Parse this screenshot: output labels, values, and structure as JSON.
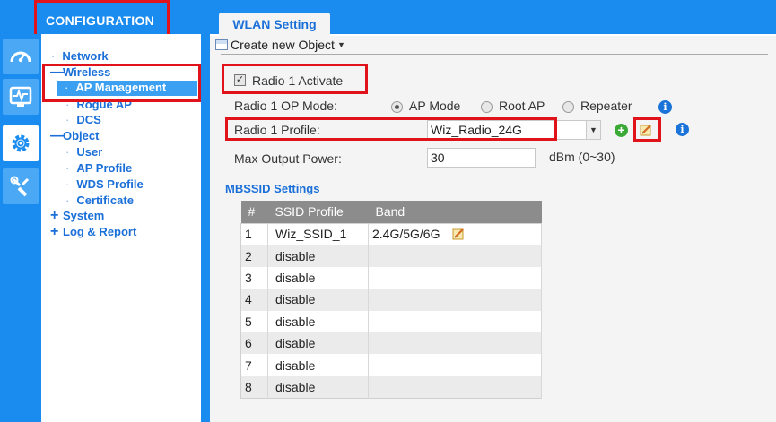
{
  "header": {
    "section_title": "CONFIGURATION"
  },
  "tabs": [
    {
      "label": "WLAN Setting"
    }
  ],
  "icon_rail": [
    {
      "icon": "dashboard-gauge-icon"
    },
    {
      "icon": "monitor-pulse-icon"
    },
    {
      "icon": "gear-icon",
      "active": true
    },
    {
      "icon": "maintenance-wrench-icon"
    }
  ],
  "nav": {
    "network": "Network",
    "wireless": "Wireless",
    "ap_management": "AP Management",
    "rogue_ap": "Rogue AP",
    "dcs": "DCS",
    "object": "Object",
    "user": "User",
    "ap_profile": "AP Profile",
    "wds_profile": "WDS Profile",
    "certificate": "Certificate",
    "system": "System",
    "log_report": "Log & Report"
  },
  "toolbar": {
    "create_label": "Create new Object"
  },
  "radio1": {
    "activate_label": "Radio 1 Activate",
    "activate_checked": true,
    "op_mode_label": "Radio 1 OP Mode:",
    "op_modes": [
      "AP Mode",
      "Root AP",
      "Repeater"
    ],
    "op_mode_selected": "AP Mode",
    "profile_label": "Radio 1 Profile:",
    "profile_value": "Wiz_Radio_24G",
    "power_label": "Max Output Power:",
    "power_value": "30",
    "power_unit": "dBm (0~30)"
  },
  "mbssid": {
    "title": "MBSSID Settings",
    "columns": [
      "#",
      "SSID Profile",
      "Band"
    ],
    "rows": [
      {
        "num": "1",
        "ssid": "Wiz_SSID_1",
        "band": "2.4G/5G/6G"
      },
      {
        "num": "2",
        "ssid": "disable",
        "band": ""
      },
      {
        "num": "3",
        "ssid": "disable",
        "band": ""
      },
      {
        "num": "4",
        "ssid": "disable",
        "band": ""
      },
      {
        "num": "5",
        "ssid": "disable",
        "band": ""
      },
      {
        "num": "6",
        "ssid": "disable",
        "band": ""
      },
      {
        "num": "7",
        "ssid": "disable",
        "band": ""
      },
      {
        "num": "8",
        "ssid": "disable",
        "band": ""
      }
    ]
  },
  "colors": {
    "brand_blue": "#1a8cf0",
    "highlight_red": "#e0121a",
    "link_blue": "#1a6fd8"
  }
}
